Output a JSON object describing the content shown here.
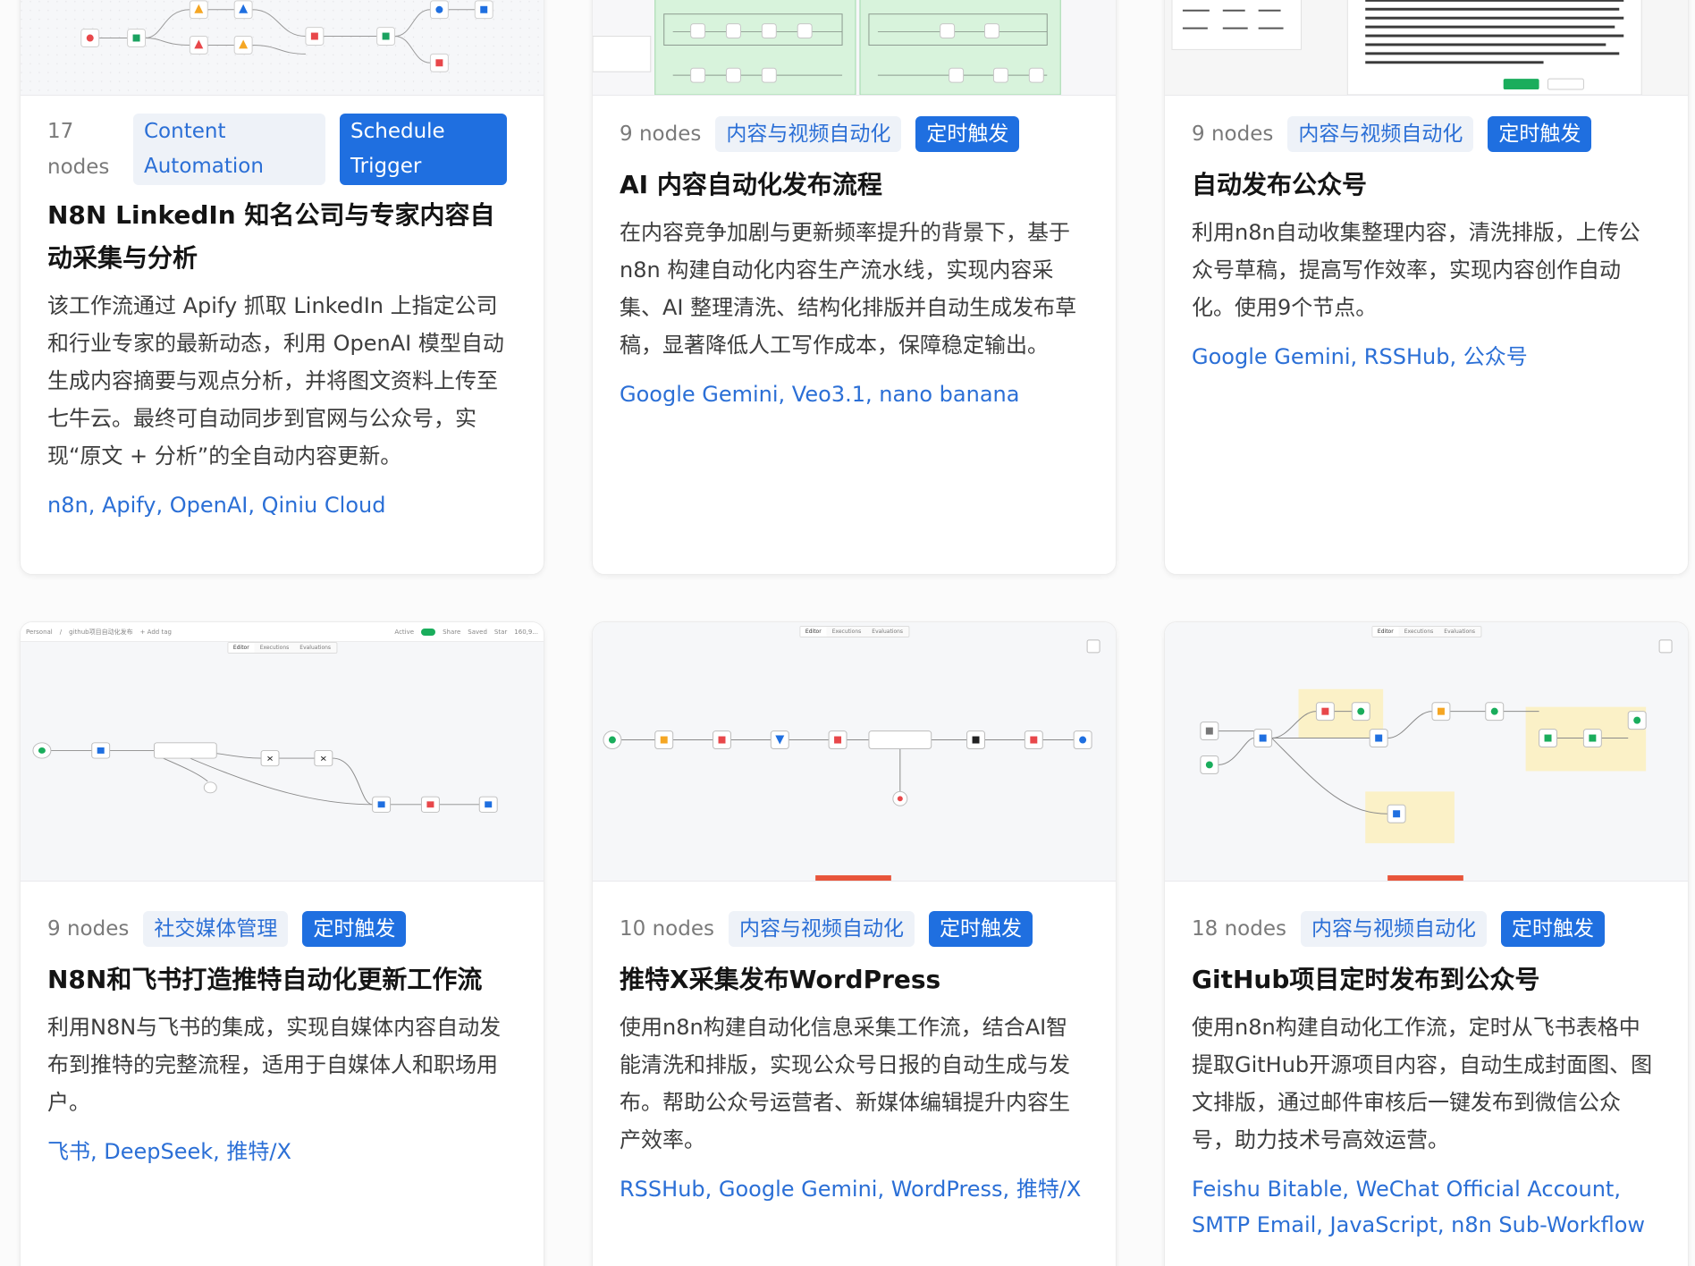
{
  "cards": [
    {
      "nodes": "17 nodes",
      "category": "Content Automation",
      "trigger": "Schedule Trigger",
      "title": "N8N LinkedIn 知名公司与专家内容自动采集与分析",
      "description": "该工作流通过 Apify 抓取 LinkedIn 上指定公司和行业专家的最新动态，利用 OpenAI 模型自动生成内容摘要与观点分析，并将图文资料上传至七牛云。最终可自动同步到官网与公众号，实现“原文 + 分析”的全自动内容更新。",
      "tools": "n8n, Apify, OpenAI, Qiniu Cloud"
    },
    {
      "nodes": "9 nodes",
      "category": "内容与视频自动化",
      "trigger": "定时触发",
      "title": "AI 内容自动化发布流程",
      "description": "在内容竞争加剧与更新频率提升的背景下，基于 n8n 构建自动化内容生产流水线，实现内容采集、AI 整理清洗、结构化排版并自动生成发布草稿，显著降低人工写作成本，保障稳定输出。",
      "tools": "Google Gemini, Veo3.1, nano banana"
    },
    {
      "nodes": "9 nodes",
      "category": "内容与视频自动化",
      "trigger": "定时触发",
      "title": "自动发布公众号",
      "description": "利用n8n自动收集整理内容，清洗排版，上传公众号草稿，提高写作效率，实现内容创作自动化。使用9个节点。",
      "tools": "Google Gemini, RSSHub, 公众号"
    },
    {
      "nodes": "9 nodes",
      "category": "社交媒体管理",
      "trigger": "定时触发",
      "title": "N8N和飞书打造推特自动化更新工作流",
      "description": "利用N8N与飞书的集成，实现自媒体内容自动发布到推特的完整流程，适用于自媒体人和职场用户。",
      "tools": "飞书, DeepSeek, 推特/X",
      "thumb_bar": [
        "Personal",
        "/",
        "github项目自动化发布",
        "+ Add tag",
        "Active",
        "Share",
        "Saved",
        "Star",
        "160,9..."
      ]
    },
    {
      "nodes": "10 nodes",
      "category": "内容与视频自动化",
      "trigger": "定时触发",
      "title": "推特X采集发布WordPress",
      "description": "使用n8n构建自动化信息采集工作流，结合AI智能清洗和排版，实现公众号日报的自动生成与发布。帮助公众号运营者、新媒体编辑提升内容生产效率。",
      "tools": "RSSHub, Google Gemini, WordPress, 推特/X"
    },
    {
      "nodes": "18 nodes",
      "category": "内容与视频自动化",
      "trigger": "定时触发",
      "title": "GitHub项目定时发布到公众号",
      "description": "使用n8n构建自动化工作流，定时从飞书表格中提取GitHub开源项目内容，自动生成封面图、图文排版，通过邮件审核后一键发布到微信公众号，助力技术号高效运营。",
      "tools": "Feishu Bitable, WeChat Official Account, SMTP Email, JavaScript, n8n Sub-Workflow"
    }
  ],
  "editor_tabs": [
    "Editor",
    "Executions",
    "Evaluations"
  ],
  "colors": {
    "accent": "#1f6fe0",
    "tag_bg": "#eef2f8",
    "link": "#2b6fd6",
    "sticky": "#fbf1c7",
    "green_canvas": "#d8f3dc"
  }
}
